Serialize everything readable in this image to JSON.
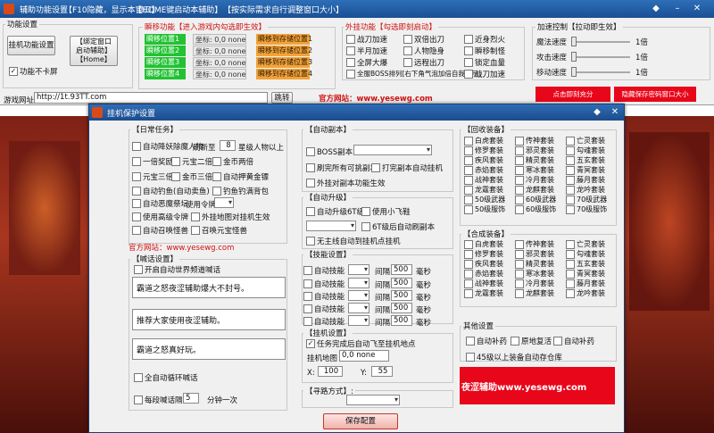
{
  "main": {
    "title": "辅助功能设置",
    "menu": [
      "【F10隐藏，显示本窗口】",
      "【HOME键启动本辅助】",
      "【按实际需求自行调整窗口大小】"
    ],
    "func_group": "功能设置",
    "func_button": "挂机功能设置",
    "bind_button": "【绑定窗口\n启动辅助】\n【Home】",
    "no_lag_label": "功能不卡屏",
    "move_group": "瞬移功能【进入游戏内勾选即生效】",
    "positions": [
      "瞬移位置1",
      "瞬移位置2",
      "瞬移位置3",
      "瞬移位置4"
    ],
    "coords": [
      "坐标: 0,0 none",
      "坐标: 0,0 none",
      "坐标: 0,0 none",
      "坐标: 0,0 none"
    ],
    "save_pos": [
      "瞬移到存储位置1",
      "瞬移到存储位置2",
      "瞬移到存储位置3",
      "瞬移到存储位置4"
    ],
    "outer_group": "外挂功能【勾选即刻启动】",
    "outer_items": [
      "战刀加速",
      "双倍出刀",
      "近身烈火",
      "半月加速",
      "人物隐身",
      "瞬移制怪",
      "全屏大爆",
      "远程出刀",
      "锁定血量",
      "全服BOSS排列[右下角气泡加倍自我提示]",
      "战刀加速"
    ],
    "speed_group": "加速控制【拉动即生效】",
    "speed_labels": [
      "魔法速度",
      "攻击速度",
      "移动速度"
    ],
    "speed_values": [
      "1倍",
      "1倍",
      "1倍"
    ],
    "url_label": "游戏网址:",
    "url_value": "http://1t.93TT.com",
    "go_button": "跳转",
    "site_text": "官方网站：www.yesewg.com",
    "left_box": "点击即刻充分",
    "right_box": "隐藏保存密码窗口大小"
  },
  "dialog": {
    "title": "挂机保护设置",
    "daily": {
      "header": "【日常任务】",
      "kill_demon": "自动降妖除魔人物",
      "refresh": "刷新至",
      "refresh_value": "8",
      "refresh_suffix": "星级人物以上",
      "row2": [
        "一倍奖励",
        "元宝二倍",
        "金币两倍"
      ],
      "row3": [
        "元宝三倍",
        "金币三倍",
        "自动押黄金镖"
      ],
      "fishing": "自动钓鱼(自动卖鱼)",
      "fishing2": "钓鱼钓满背包",
      "evil": "自动恶魔祭坛",
      "use_token": "使用令牌",
      "adv_token": "使用高级令牌",
      "outer_map": "外挂地图对挂机生效",
      "call_mine": "自动召唤怪兽",
      "call_yuanbao": "召唤元宝怪兽",
      "website": "官方网站：www.yesewg.com"
    },
    "shout": {
      "header": "【喊话设置】",
      "open_world": "开启自动世界频道喊话",
      "messages": [
        "霸道之怒夜涩辅助爆大不封号。",
        "推荐大家使用夜涩辅助。",
        "霸道之怒真好玩。"
      ],
      "loop": "全自动循环喊话",
      "interval_label": "每段喊话隔",
      "interval_value": "5",
      "interval_unit": "分钟一次"
    },
    "instance": {
      "header": "【自动副本】",
      "boss": "BOSS副本",
      "refresh_all": "刷完所有可挑副本",
      "open_hang": "打完副本自动挂机",
      "outer_effect": "外挂对副本功能生效"
    },
    "upgrade": {
      "header": "【自动升级】",
      "to61": "自动升级6T级",
      "flying": "使用小飞鞋",
      "after61": "6T级后自动刷副本",
      "no_auto": "无主线自动到挂机点挂机"
    },
    "skill": {
      "header": "【技能设置】",
      "rows": [
        {
          "name": "自动技能",
          "interval": "间隔",
          "ms": "500",
          "unit": "毫秒"
        },
        {
          "name": "自动技能",
          "interval": "间隔",
          "ms": "500",
          "unit": "毫秒"
        },
        {
          "name": "自动技能",
          "interval": "间隔",
          "ms": "500",
          "unit": "毫秒"
        },
        {
          "name": "自动技能",
          "interval": "间隔",
          "ms": "500",
          "unit": "毫秒"
        },
        {
          "name": "自动技能",
          "interval": "间隔",
          "ms": "500",
          "unit": "毫秒"
        }
      ]
    },
    "hangpoint": {
      "header": "【挂机设置】",
      "fly_to": "任务完成后自动飞至挂机地点",
      "map_label": "挂机地图",
      "map_value": "0,0 none",
      "x_label": "X:",
      "x_value": "100",
      "y_label": "Y:",
      "y_value": "55"
    },
    "path": {
      "header": "【寻路方式】:"
    },
    "pickup": {
      "header": "【回收装备】",
      "items": [
        "白虎套装",
        "传神套装",
        "亡灵套装",
        "修罗套装",
        "邪灵套装",
        "勾魂套装",
        "疾风套装",
        "精灵套装",
        "五玄套装",
        "赤焰套装",
        "寒冰套装",
        "青冥套装",
        "战神套装",
        "冷月套装",
        "藤月套装",
        "龙霆套装",
        "龙麒套装",
        "龙吟套装",
        "50级武器",
        "60级武器",
        "70级武器",
        "50级服饰",
        "60级服饰",
        "70级服饰"
      ]
    },
    "compose": {
      "header": "【合成装备】",
      "items": [
        "白虎套装",
        "传神套装",
        "亡灵套装",
        "修罗套装",
        "邪灵套装",
        "勾魂套装",
        "疾风套装",
        "精灵套装",
        "五玄套装",
        "赤焰套装",
        "寒冰套装",
        "青冥套装",
        "战神套装",
        "冷月套装",
        "藤月套装",
        "龙霆套装",
        "龙麒套装",
        "龙吟套装"
      ]
    },
    "other": {
      "header": "其他设置",
      "row1": [
        "自动补药",
        "原地复活",
        "自动补药"
      ],
      "store": "45级以上装备自动存仓库"
    },
    "ad": "夜涩辅助www.yesewg.com",
    "save": "保存配置"
  },
  "colors": {
    "title_blue": "#1b4f93",
    "green": "#22c233",
    "orange": "#f2a23a",
    "ad_red": "#e8061a"
  }
}
